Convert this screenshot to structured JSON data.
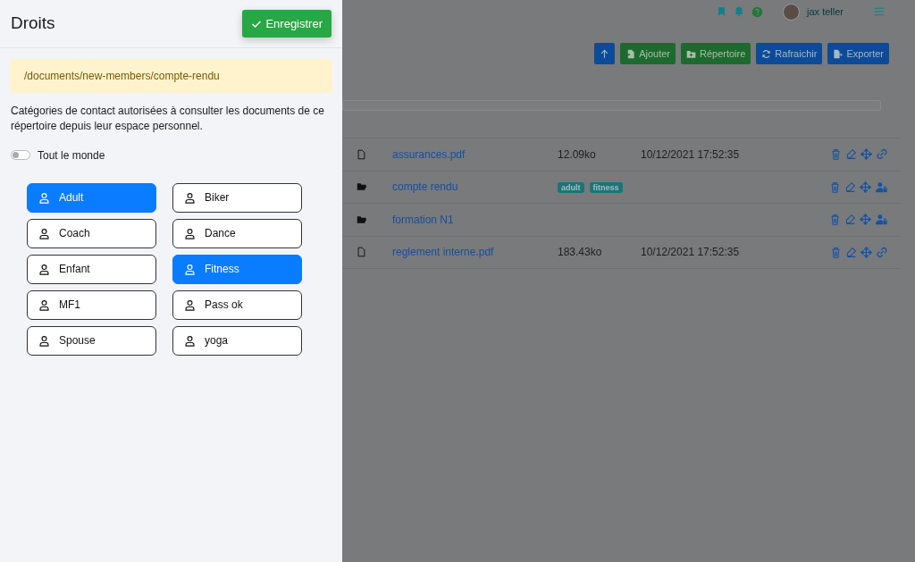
{
  "header": {
    "user_name": "jax teller"
  },
  "toolbar": {
    "buttons": [
      {
        "kind": "add",
        "label": "Ajouter"
      },
      {
        "kind": "folder",
        "label": "Répertoire"
      },
      {
        "kind": "refresh",
        "label": "Rafraichir"
      },
      {
        "kind": "export",
        "label": "Exporter"
      }
    ]
  },
  "files": [
    {
      "kind": "file",
      "name": "assurances.pdf",
      "size": "12.09ko",
      "date": "10/12/2021 17:52:35"
    },
    {
      "kind": "folder",
      "name": "compte rendu",
      "tags": [
        "adult",
        "fitness"
      ]
    },
    {
      "kind": "folder",
      "name": "formation N1"
    },
    {
      "kind": "file",
      "name": "reglement interne.pdf",
      "size": "183.43ko",
      "date": "10/12/2021 17:52:35"
    }
  ],
  "panel": {
    "title": "Droits",
    "save_button": "Enregistrer",
    "path": "/documents/new-members/compte-rendu",
    "description": "Catégories de contact autorisées à consulter les documents de ce répertoire depuis leur espace personnel.",
    "everyone_toggle": {
      "label": "Tout le monde",
      "on": false
    },
    "categories": [
      {
        "label": "Adult",
        "selected": true
      },
      {
        "label": "Biker",
        "selected": false
      },
      {
        "label": "Coach",
        "selected": false
      },
      {
        "label": "Dance",
        "selected": false
      },
      {
        "label": "Enfant",
        "selected": false
      },
      {
        "label": "Fitness",
        "selected": true
      },
      {
        "label": "MF1",
        "selected": false
      },
      {
        "label": "Pass ok",
        "selected": false
      },
      {
        "label": "Spouse",
        "selected": false
      },
      {
        "label": "yoga",
        "selected": false
      }
    ]
  }
}
